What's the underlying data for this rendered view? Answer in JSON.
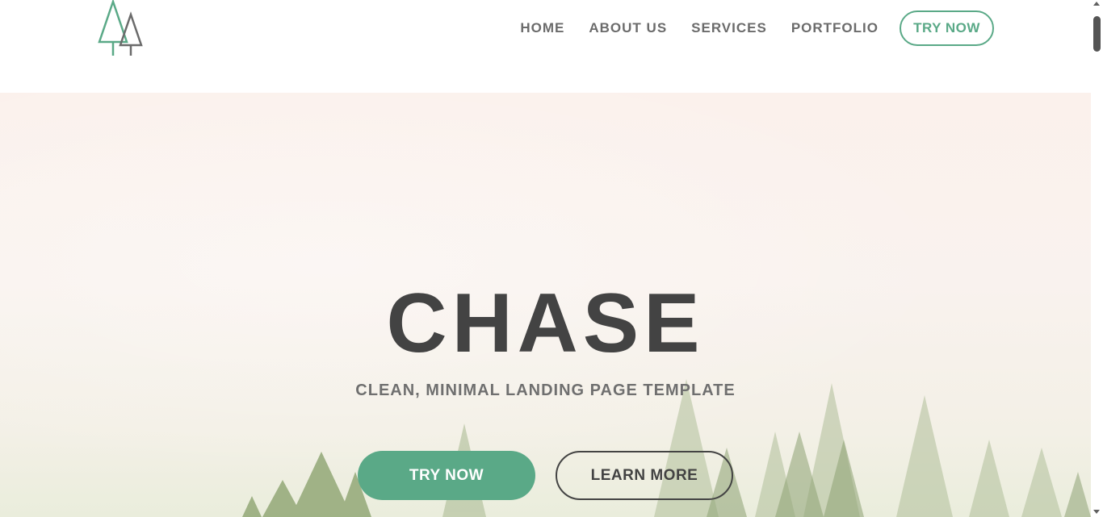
{
  "header": {
    "logo_icon": "pine-trees-icon",
    "nav": [
      {
        "label": "HOME"
      },
      {
        "label": "ABOUT US"
      },
      {
        "label": "SERVICES"
      },
      {
        "label": "PORTFOLIO"
      }
    ],
    "cta_label": "TRY NOW"
  },
  "hero": {
    "title": "CHASE",
    "subtitle": "CLEAN, MINIMAL LANDING PAGE TEMPLATE",
    "primary_button": "TRY NOW",
    "secondary_button": "LEARN MORE",
    "background": "misty-forest-image"
  },
  "colors": {
    "accent": "#5aa987",
    "text_dark": "#434343",
    "nav_text": "#6b6b6b"
  }
}
